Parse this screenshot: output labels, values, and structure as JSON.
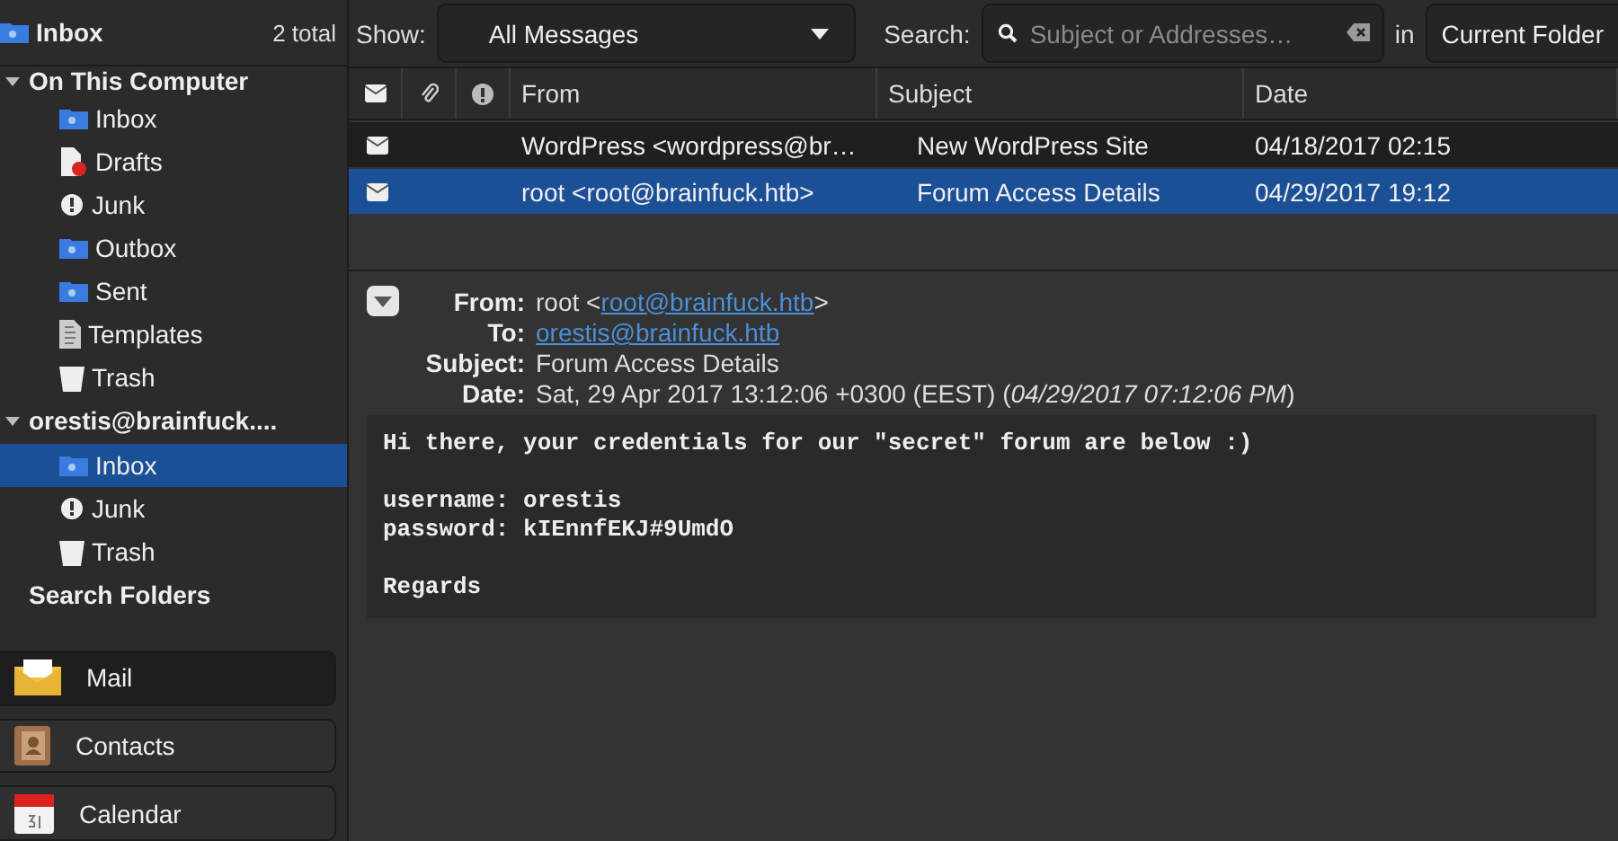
{
  "folder_header": {
    "title": "Inbox",
    "count": "2 total"
  },
  "folder_tree": [
    {
      "label": "On This Computer",
      "kind": "account",
      "expanded": true,
      "children": [
        {
          "label": "Inbox",
          "kind": "inbox",
          "selected": false
        },
        {
          "label": "Drafts",
          "kind": "drafts",
          "selected": false
        },
        {
          "label": "Junk",
          "kind": "junk",
          "selected": false
        },
        {
          "label": "Outbox",
          "kind": "outbox",
          "selected": false
        },
        {
          "label": "Sent",
          "kind": "sent",
          "selected": false
        },
        {
          "label": "Templates",
          "kind": "templates",
          "selected": false
        },
        {
          "label": "Trash",
          "kind": "trash",
          "selected": false
        }
      ]
    },
    {
      "label": "orestis@brainfuck....",
      "kind": "account",
      "expanded": true,
      "children": [
        {
          "label": "Inbox",
          "kind": "inbox",
          "selected": true
        },
        {
          "label": "Junk",
          "kind": "junk",
          "selected": false
        },
        {
          "label": "Trash",
          "kind": "trash",
          "selected": false
        }
      ]
    },
    {
      "label": "Search Folders",
      "kind": "section"
    }
  ],
  "mode_buttons": [
    {
      "label": "Mail",
      "kind": "mail",
      "selected": true
    },
    {
      "label": "Contacts",
      "kind": "contacts",
      "selected": false
    },
    {
      "label": "Calendar",
      "kind": "calendar",
      "selected": false
    }
  ],
  "filter_bar": {
    "show_label": "Show:",
    "show_value": "All Messages",
    "search_label": "Search:",
    "search_placeholder": "Subject or Addresses…",
    "in_label": "in",
    "scope": "Current Folder"
  },
  "message_list": {
    "columns": [
      "From",
      "Subject",
      "Date"
    ],
    "rows": [
      {
        "from": "WordPress <wordpress@br…",
        "subject": "New WordPress Site",
        "date": "04/18/2017 02:15",
        "selected": false
      },
      {
        "from": "root <root@brainfuck.htb>",
        "subject": "Forum Access Details",
        "date": "04/29/2017 19:12",
        "selected": true
      }
    ]
  },
  "message_header": {
    "fields": [
      {
        "label": "From:",
        "prefix": "root <",
        "link": "root@brainfuck.htb",
        "suffix": ">"
      },
      {
        "label": "To:",
        "link": "orestis@brainfuck.htb"
      },
      {
        "label": "Subject:",
        "text": "Forum Access Details"
      },
      {
        "label": "Date:",
        "text": "Sat, 29 Apr 2017 13:12:06 +0300 (EEST) (*04/29/2017 07:12:06 PM*)"
      }
    ]
  },
  "message_body": "Hi there, your credentials for our \"secret\" forum are below :)\n\nusername: orestis\npassword: kIEnnfEKJ#9UmdO\n\nRegards"
}
